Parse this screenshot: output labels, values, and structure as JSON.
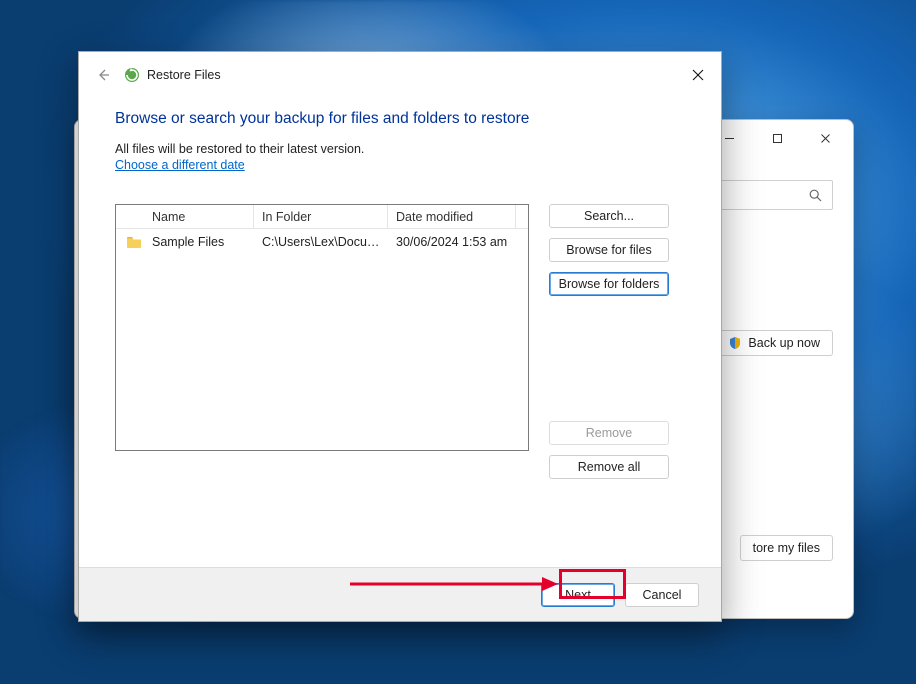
{
  "dialog": {
    "title": "Restore Files",
    "heading": "Browse or search your backup for files and folders to restore",
    "subtext": "All files will be restored to their latest version.",
    "link": "Choose a different date",
    "columns": {
      "name": "Name",
      "folder": "In Folder",
      "date": "Date modified"
    },
    "row": {
      "name": "Sample Files",
      "folder": "C:\\Users\\Lex\\Docume...",
      "date": "30/06/2024 1:53 am"
    },
    "buttons": {
      "search": "Search...",
      "browse_files": "Browse for files",
      "browse_folders": "Browse for folders",
      "remove": "Remove",
      "remove_all": "Remove all",
      "next": "Next",
      "cancel": "Cancel"
    }
  },
  "background": {
    "backup_now": "Back up now",
    "restore_my_files": "tore my files"
  }
}
